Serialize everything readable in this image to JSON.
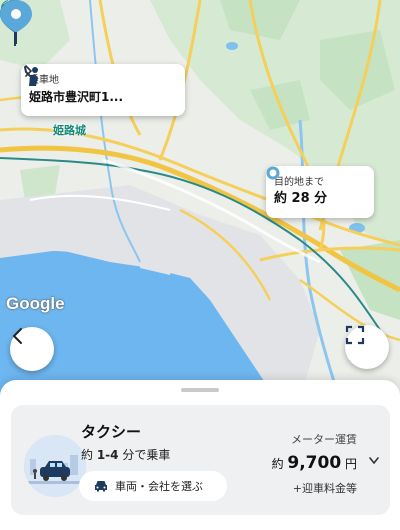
{
  "pickup": {
    "label": "乗車地",
    "address": "姫路市豊沢町1..."
  },
  "destination": {
    "label": "目的地まで",
    "eta": "約 28 分"
  },
  "map": {
    "landmark": "姫路城",
    "attribution": "Google",
    "colors": {
      "water": "#6db6f0",
      "land": "#eef0ed",
      "green": "#cfe8cf",
      "road": "#f4c94a",
      "pin": "#1f3a5f",
      "pin_dest": "#5aa7d9"
    }
  },
  "controls": {
    "back_icon": "chevron-left-icon",
    "expand_icon": "fullscreen-icon"
  },
  "taxi": {
    "title": "タクシー",
    "wait_prefix": "約 ",
    "wait_range": "1-4",
    "wait_suffix": " 分で乗車",
    "choose_label": "車両・会社を選ぶ",
    "fare_label": "メーター運賃",
    "fare_prefix": "約 ",
    "fare_amount": "9,700",
    "fare_unit": " 円",
    "fare_extra": "+迎車料金等"
  }
}
